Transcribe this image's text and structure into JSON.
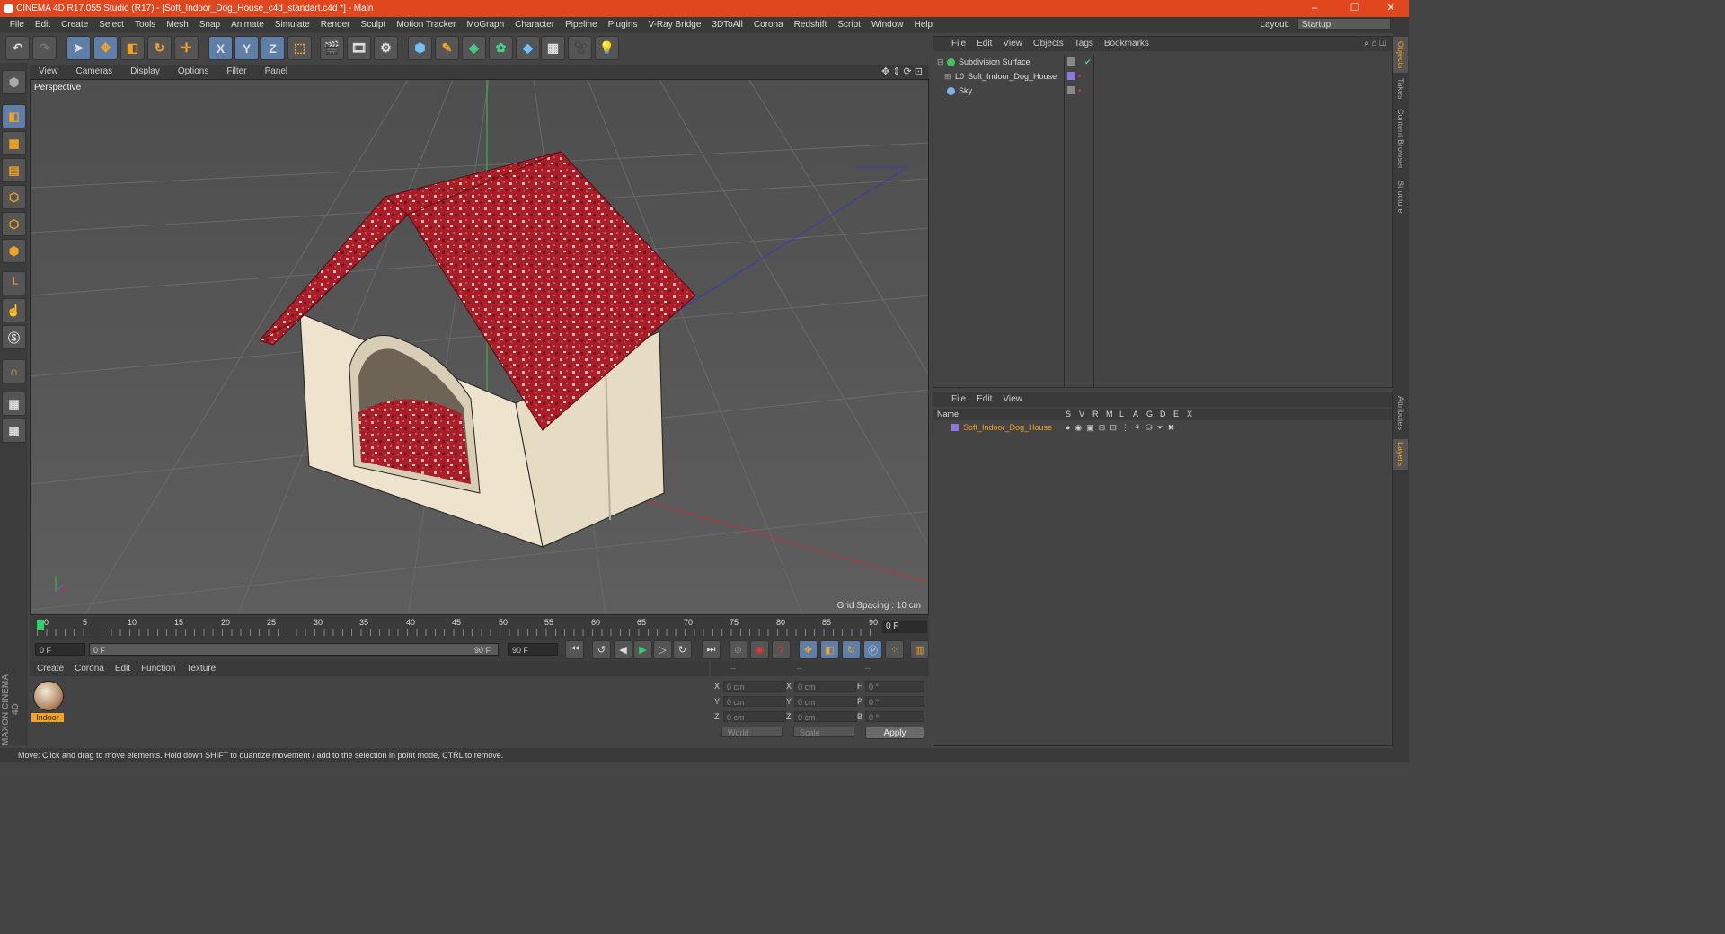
{
  "titlebar": {
    "title": "CINEMA 4D R17.055 Studio (R17) - [Soft_Indoor_Dog_House_c4d_standart.c4d *] - Main",
    "minimize": "–",
    "restore": "❐",
    "close": "✕"
  },
  "menubar": {
    "items": [
      "File",
      "Edit",
      "Create",
      "Select",
      "Tools",
      "Mesh",
      "Snap",
      "Animate",
      "Simulate",
      "Render",
      "Sculpt",
      "Motion Tracker",
      "MoGraph",
      "Character",
      "Pipeline",
      "Plugins",
      "V-Ray Bridge",
      "3DToAll",
      "Corona",
      "Redshift",
      "Script",
      "Window",
      "Help"
    ],
    "layout_label": "Layout:",
    "layout_value": "Startup"
  },
  "toolbar": {
    "x_label": "X",
    "y_label": "Y",
    "z_label": "Z"
  },
  "viewport": {
    "menu": [
      "View",
      "Cameras",
      "Display",
      "Options",
      "Filter",
      "Panel"
    ],
    "view_name": "Perspective",
    "grid_spacing": "Grid Spacing : 10 cm"
  },
  "timeline": {
    "ticks": [
      "0",
      "5",
      "10",
      "15",
      "20",
      "25",
      "30",
      "35",
      "40",
      "45",
      "50",
      "55",
      "60",
      "65",
      "70",
      "75",
      "80",
      "85",
      "90"
    ],
    "current_frame": "0 F",
    "start_field": "0 F",
    "range_start": "0 F",
    "range_end": "90 F",
    "end_field": "90 F"
  },
  "material_panel": {
    "menu": [
      "Create",
      "Corona",
      "Edit",
      "Function",
      "Texture"
    ],
    "material_name": "Indoor"
  },
  "coord_panel": {
    "header": [
      "--",
      "--",
      "--"
    ],
    "rows": [
      {
        "a": "X",
        "av": "0 cm",
        "b": "X",
        "bv": "0 cm",
        "c": "H",
        "cv": "0 °"
      },
      {
        "a": "Y",
        "av": "0 cm",
        "b": "Y",
        "bv": "0 cm",
        "c": "P",
        "cv": "0 °"
      },
      {
        "a": "Z",
        "av": "0 cm",
        "b": "Z",
        "bv": "0 cm",
        "c": "B",
        "cv": "0 °"
      }
    ],
    "world_select": "World",
    "scale_select": "Scale",
    "apply_label": "Apply"
  },
  "object_manager": {
    "menu": [
      "File",
      "Edit",
      "View",
      "Objects",
      "Tags",
      "Bookmarks"
    ],
    "objects": [
      {
        "name": "Subdivision Surface",
        "icon_color": "#46c35a"
      },
      {
        "name": "Soft_Indoor_Dog_House",
        "icon_color": "#cccccc"
      },
      {
        "name": "Sky",
        "icon_color": "#7fb3ea"
      }
    ]
  },
  "layer_manager": {
    "menu": [
      "File",
      "Edit",
      "View"
    ],
    "columns": [
      "Name",
      "S",
      "V",
      "R",
      "M",
      "L",
      "A",
      "G",
      "D",
      "E",
      "X"
    ],
    "layers": [
      {
        "name": "Soft_Indoor_Dog_House",
        "color": "#8a78e0"
      }
    ]
  },
  "side_tabs": [
    "Objects",
    "Takes",
    "Content Browser",
    "Structure",
    "Attributes",
    "Layers"
  ],
  "logo": {
    "text": "MAXON CINEMA 4D"
  },
  "status": {
    "text": "Move: Click and drag to move elements. Hold down SHIFT to quantize movement / add to the selection in point mode, CTRL to remove."
  },
  "colors": {
    "accent": "#f5a323",
    "titlebar": "#e0471e",
    "roof_red": "#b3222c",
    "house_cream": "#eee3cd"
  }
}
